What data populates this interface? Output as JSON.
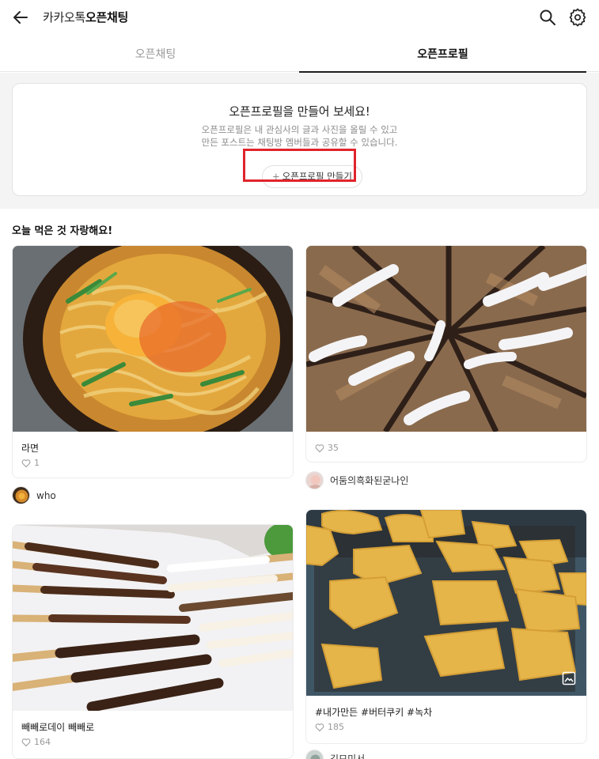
{
  "header": {
    "brand": "카카오톡",
    "title_strong": "오픈채팅"
  },
  "tabs": [
    {
      "label": "오픈채팅",
      "active": false
    },
    {
      "label": "오픈프로필",
      "active": true
    }
  ],
  "promo": {
    "title": "오픈프로필을 만들어 보세요!",
    "desc_line1": "오픈프로필은 내 관심사의 글과 사진을 올릴 수 있고",
    "desc_line2": "만든 포스트는 채팅방 멤버들과 공유할 수 있습니다.",
    "button_plus": "+",
    "button_label": "오픈프로필 만들기"
  },
  "section": {
    "title": "오늘 먹은 것 자랑해요!"
  },
  "posts": [
    {
      "caption": "라면",
      "likes": "1",
      "author": "who",
      "image": "ramen-photo"
    },
    {
      "caption": "",
      "likes": "35",
      "author": "어둠의흑화된굳나인",
      "image": "pastry-photo"
    },
    {
      "caption": "빼빼로데이 빼빼로",
      "likes": "164",
      "author": "",
      "image": "pepero-photo"
    },
    {
      "caption": "#내가만든 #버터쿠키 #녹차",
      "likes": "185",
      "author": "김모미서",
      "image": "cookies-photo"
    }
  ],
  "icons": {
    "back": "arrow-left-icon",
    "search": "search-icon",
    "settings": "gear-icon",
    "heart": "heart-icon",
    "gallery": "gallery-icon"
  },
  "colors": {
    "highlight": "#e0242b",
    "text": "#1e1e1e",
    "muted": "#999999"
  }
}
